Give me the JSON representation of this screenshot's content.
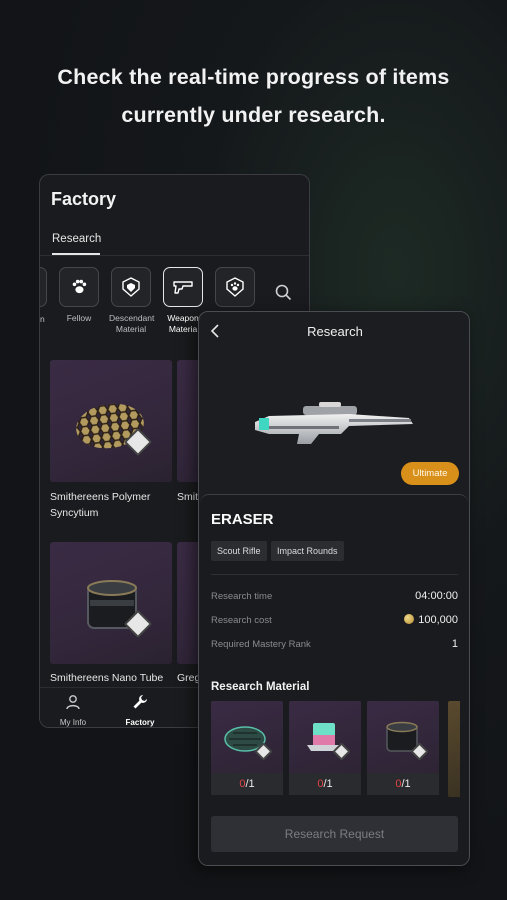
{
  "headline": {
    "line1": "Check the real-time progress of items",
    "line2": "currently under research."
  },
  "factory": {
    "title": "Factory",
    "tab": "Research",
    "categories": [
      {
        "label": "Fellow",
        "icon": "paw-icon"
      },
      {
        "label": "Descendant\nMaterial",
        "icon": "shield-badge-icon"
      },
      {
        "label": "Weapon\nMateria",
        "icon": "gun-icon"
      },
      {
        "label": "",
        "icon": "paw-badge-icon"
      }
    ],
    "clipped_label": "n",
    "items": [
      {
        "name": "Smithereens Polymer Syncytium"
      },
      {
        "name": "Smit Fiber"
      },
      {
        "name": "Smithereens Nano Tube"
      },
      {
        "name": "Greg"
      }
    ],
    "nav": [
      {
        "label": "My Info",
        "icon": "person-icon"
      },
      {
        "label": "Factory",
        "icon": "wrench-icon"
      },
      {
        "label": "",
        "icon": ""
      }
    ]
  },
  "research": {
    "title": "Research",
    "rarity": "Ultimate",
    "item_name": "ERASER",
    "tags": [
      "Scout Rifle",
      "Impact Rounds"
    ],
    "stats": [
      {
        "label": "Research time",
        "value": "04:00:00"
      },
      {
        "label": "Research cost",
        "value": "100,000"
      },
      {
        "label": "Required Mastery Rank",
        "value": "1"
      }
    ],
    "materials_title": "Research Material",
    "materials": [
      {
        "have": "0",
        "need": "/1"
      },
      {
        "have": "0",
        "need": "/1"
      },
      {
        "have": "0",
        "need": "/1"
      }
    ],
    "button": "Research Request"
  },
  "colors": {
    "ultimate": "#d9901b",
    "material_bg": "#3a2b44",
    "count_zero": "#e04545"
  }
}
